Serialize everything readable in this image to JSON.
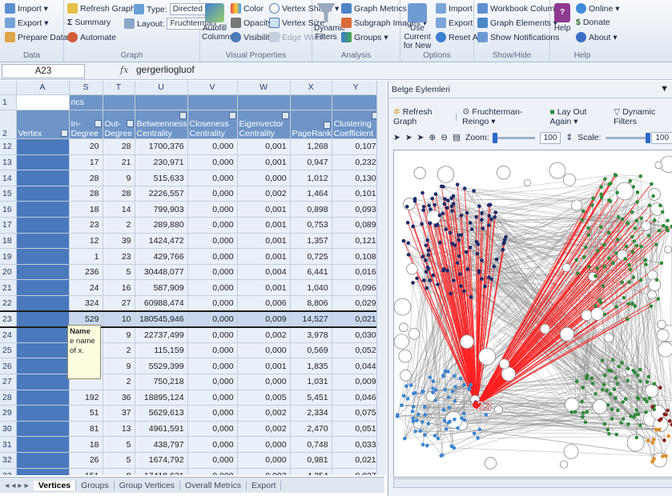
{
  "ribbon": {
    "data": {
      "label": "Data",
      "import": "Import ▾",
      "export": "Export ▾",
      "prepare": "Prepare Data ▾"
    },
    "graph": {
      "label": "Graph",
      "refresh": "Refresh Graph",
      "type_label": "Type:",
      "type_value": "Directed",
      "summary": "Summary",
      "layout_label": "Layout:",
      "layout_value": "Fruchterman...",
      "automate": "Automate"
    },
    "visual": {
      "label": "Visual Properties",
      "autofill": "Autofill Columns",
      "color": "Color",
      "opacity": "Opacity",
      "visibility": "Visibility ▾",
      "vertex_shape": "Vertex Shape ▾",
      "vertex_size": "Vertex Size",
      "edge_width": "Edge Width"
    },
    "analysis": {
      "label": "Analysis",
      "dynamic_filters": "Dynamic Filters",
      "graph_metrics": "Graph Metrics ▾",
      "subgraph_images": "Subgraph Images ▾",
      "groups": "Groups ▾"
    },
    "options": {
      "label": "Options",
      "use_current": "Use Current for New",
      "import": "Import",
      "export": "Export",
      "reset_all": "Reset All"
    },
    "showhide": {
      "label": "Show/Hide",
      "workbook_columns": "Workbook Columns ▾",
      "graph_elements": "Graph Elements ▾",
      "show_notifications": "Show Notifications"
    },
    "help": {
      "label": "Help",
      "help": "Help",
      "online": "Online ▾",
      "donate": "Donate",
      "about": "About ▾"
    }
  },
  "formula_bar": {
    "name_box": "A23",
    "fx": "fx",
    "value": "gergerliogluof"
  },
  "sheet": {
    "columns": [
      "A",
      "S",
      "T",
      "U",
      "V",
      "W",
      "X",
      "Y"
    ],
    "row1": {
      "num": "1",
      "s": "rics"
    },
    "header": {
      "num": "2",
      "a": "Vertex",
      "s": "In-Degree",
      "t": "Out-Degree",
      "u": "Betweenness Centrality",
      "v": "Closeness Centrality",
      "w": "Eigenvector Centrality",
      "x": "PageRank",
      "y": "Clustering Coefficient"
    },
    "rows": [
      {
        "n": "12",
        "s": "20",
        "t": "28",
        "u": "1700,376",
        "v": "0,000",
        "w": "0,001",
        "x": "1,268",
        "y": "0,107"
      },
      {
        "n": "13",
        "s": "17",
        "t": "21",
        "u": "230,971",
        "v": "0,000",
        "w": "0,001",
        "x": "0,947",
        "y": "0,232"
      },
      {
        "n": "14",
        "s": "28",
        "t": "9",
        "u": "515,633",
        "v": "0,000",
        "w": "0,000",
        "x": "1,012",
        "y": "0,130"
      },
      {
        "n": "15",
        "s": "28",
        "t": "28",
        "u": "2226,557",
        "v": "0,000",
        "w": "0,002",
        "x": "1,464",
        "y": "0,101"
      },
      {
        "n": "16",
        "s": "18",
        "t": "14",
        "u": "799,903",
        "v": "0,000",
        "w": "0,001",
        "x": "0,898",
        "y": "0,093"
      },
      {
        "n": "17",
        "s": "23",
        "t": "2",
        "u": "289,880",
        "v": "0,000",
        "w": "0,001",
        "x": "0,753",
        "y": "0,089"
      },
      {
        "n": "18",
        "s": "12",
        "t": "39",
        "u": "1424,472",
        "v": "0,000",
        "w": "0,001",
        "x": "1,357",
        "y": "0,121"
      },
      {
        "n": "19",
        "s": "1",
        "t": "23",
        "u": "429,766",
        "v": "0,000",
        "w": "0,001",
        "x": "0,725",
        "y": "0,108"
      },
      {
        "n": "20",
        "s": "236",
        "t": "5",
        "u": "30448,077",
        "v": "0,000",
        "w": "0,004",
        "x": "6,441",
        "y": "0,016"
      },
      {
        "n": "21",
        "s": "24",
        "t": "16",
        "u": "587,909",
        "v": "0,000",
        "w": "0,001",
        "x": "1,040",
        "y": "0,096"
      },
      {
        "n": "22",
        "s": "324",
        "t": "27",
        "u": "60988,474",
        "v": "0,000",
        "w": "0,006",
        "x": "8,806",
        "y": "0,029"
      },
      {
        "n": "23",
        "s": "529",
        "t": "10",
        "u": "180545,946",
        "v": "0,000",
        "w": "0,009",
        "x": "14,527",
        "y": "0,021",
        "selected": true
      },
      {
        "n": "24",
        "s": "",
        "t": "9",
        "u": "22737,499",
        "v": "0,000",
        "w": "0,002",
        "x": "3,978",
        "y": "0,030"
      },
      {
        "n": "25",
        "s": "",
        "t": "2",
        "u": "115,159",
        "v": "0,000",
        "w": "0,000",
        "x": "0,569",
        "y": "0,052"
      },
      {
        "n": "26",
        "s": "",
        "t": "9",
        "u": "5529,399",
        "v": "0,000",
        "w": "0,001",
        "x": "1,835",
        "y": "0,044"
      },
      {
        "n": "27",
        "s": "",
        "t": "2",
        "u": "750,218",
        "v": "0,000",
        "w": "0,000",
        "x": "1,031",
        "y": "0,009"
      },
      {
        "n": "28",
        "s": "192",
        "t": "36",
        "u": "18895,124",
        "v": "0,000",
        "w": "0,005",
        "x": "5,451",
        "y": "0,046"
      },
      {
        "n": "29",
        "s": "51",
        "t": "37",
        "u": "5629,613",
        "v": "0,000",
        "w": "0,002",
        "x": "2,334",
        "y": "0,075"
      },
      {
        "n": "30",
        "s": "81",
        "t": "13",
        "u": "4961,591",
        "v": "0,000",
        "w": "0,002",
        "x": "2,470",
        "y": "0,051"
      },
      {
        "n": "31",
        "s": "18",
        "t": "5",
        "u": "438,797",
        "v": "0,000",
        "w": "0,000",
        "x": "0,748",
        "y": "0,033"
      },
      {
        "n": "32",
        "s": "26",
        "t": "5",
        "u": "1674,792",
        "v": "0,000",
        "w": "0,000",
        "x": "0,981",
        "y": "0,021"
      },
      {
        "n": "33",
        "s": "151",
        "t": "8",
        "u": "17418,621",
        "v": "0,000",
        "w": "0,003",
        "x": "4,254",
        "y": "0,027"
      }
    ],
    "tooltip": {
      "title": "Name",
      "body": "e name of x."
    }
  },
  "tabs": [
    "Vertices",
    "Groups",
    "Group Vertices",
    "Overall Metrics",
    "Export"
  ],
  "panel": {
    "title": "Belge Eylemleri",
    "refresh": "Refresh Graph",
    "layout": "Fruchterman-Reingo ▾",
    "layout_again": "Lay Out Again ▾",
    "dynamic_filters": "Dynamic Filters",
    "zoom_label": "Zoom:",
    "zoom_value": "100",
    "scale_label": "Scale:",
    "scale_value": "100",
    "graph_label": "23"
  },
  "colors": {
    "accent": "#4b79bd",
    "header": "#6f95c8",
    "edge_red": "#ff2020",
    "edge_gray": "#8a8a8a",
    "node_navy": "#1b2a6b",
    "node_green": "#2e8b3a",
    "node_blue": "#3a86d4",
    "node_orange": "#e28a22",
    "node_darkred": "#8b1a1a"
  }
}
